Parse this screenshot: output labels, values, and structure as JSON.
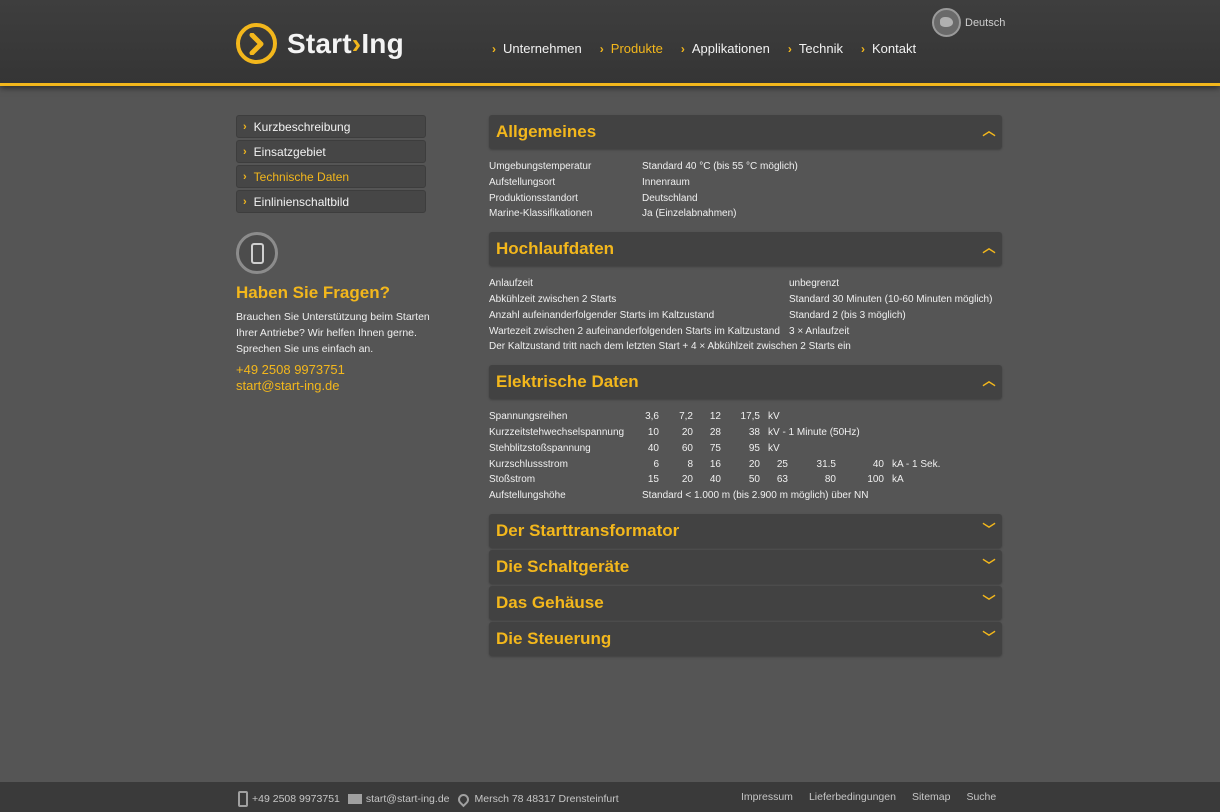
{
  "header": {
    "brand": {
      "part1": "Start",
      "sep": "›",
      "part2": "Ing"
    },
    "language": "Deutsch",
    "nav": [
      {
        "label": "Unternehmen",
        "active": false
      },
      {
        "label": "Produkte",
        "active": true
      },
      {
        "label": "Applikationen",
        "active": false
      },
      {
        "label": "Technik",
        "active": false
      },
      {
        "label": "Kontakt",
        "active": false
      }
    ]
  },
  "sidebar": {
    "items": [
      {
        "label": "Kurzbeschreibung",
        "active": false
      },
      {
        "label": "Einsatzgebiet",
        "active": false
      },
      {
        "label": "Technische Daten",
        "active": true
      },
      {
        "label": "Einlinienschaltbild",
        "active": false
      }
    ],
    "help": {
      "title": "Haben Sie Fragen?",
      "text": "Brauchen Sie Unterstützung beim Starten Ihrer Antriebe? Wir helfen Ihnen gerne. Sprechen Sie uns einfach an.",
      "phone": "+49 2508 9973751",
      "email": "start@start-ing.de"
    }
  },
  "sections": {
    "allgemeines": {
      "title": "Allgemeines",
      "rows": [
        {
          "k": "Umgebungstemperatur",
          "v": "Standard 40 °C (bis 55 °C möglich)"
        },
        {
          "k": "Aufstellungsort",
          "v": "Innenraum"
        },
        {
          "k": "Produktionsstandort",
          "v": "Deutschland"
        },
        {
          "k": "Marine-Klassifikationen",
          "v": "Ja (Einzelabnahmen)"
        }
      ]
    },
    "hochlauf": {
      "title": "Hochlaufdaten",
      "rows": [
        {
          "k": "Anlaufzeit",
          "v": "unbegrenzt"
        },
        {
          "k": "Abkühlzeit zwischen 2 Starts",
          "v": "Standard 30 Minuten (10-60 Minuten möglich)"
        },
        {
          "k": "Anzahl aufeinanderfolgender Starts im Kaltzustand",
          "v": "Standard 2 (bis 3 möglich)"
        },
        {
          "k": "Wartezeit zwischen 2 aufeinanderfolgenden Starts im Kaltzustand",
          "v": "3 × Anlaufzeit"
        }
      ],
      "note": "Der Kaltzustand tritt nach dem letzten Start + 4 × Abkühlzeit zwischen 2 Starts ein"
    },
    "elektrisch": {
      "title": "Elektrische Daten",
      "spannung": {
        "k": "Spannungsreihen",
        "vals": [
          "3,6",
          "7,2",
          "12",
          "17,5"
        ],
        "unit": "kV"
      },
      "kurzzeit": {
        "k": "Kurzzeitstehwechselspannung",
        "vals": [
          "10",
          "20",
          "28",
          "38"
        ],
        "unit": "kV - 1 Minute (50Hz)"
      },
      "blitz": {
        "k": "Stehblitzstoßspannung",
        "vals": [
          "40",
          "60",
          "75",
          "95"
        ],
        "unit": "kV"
      },
      "kurzschluss": {
        "k": "Kurzschlussstrom",
        "vals": [
          "6",
          "8",
          "16",
          "20",
          "25",
          "31.5",
          "40"
        ],
        "unit": "kA - 1 Sek."
      },
      "stoss": {
        "k": "Stoßstrom",
        "vals": [
          "15",
          "20",
          "40",
          "50",
          "63",
          "80",
          "100"
        ],
        "unit": "kA"
      },
      "hoehe": {
        "k": "Aufstellungshöhe",
        "v": "Standard < 1.000 m (bis 2.900 m möglich) über NN"
      }
    },
    "collapsed": [
      {
        "title": "Der Starttransformator"
      },
      {
        "title": "Die Schaltgeräte"
      },
      {
        "title": "Das Gehäuse"
      },
      {
        "title": "Die Steuerung"
      }
    ]
  },
  "footer": {
    "phone": "+49 2508 9973751",
    "email": "start@start-ing.de",
    "address": "Mersch 78 48317 Drensteinfurt",
    "links": [
      "Impressum",
      "Lieferbedingungen",
      "Sitemap",
      "Suche"
    ]
  },
  "icons": {
    "expanded": "chevron-up-icon",
    "collapsed": "chevron-down-icon"
  },
  "colors": {
    "accent": "#f3b71c",
    "background": "#555555",
    "header": "#3a3a3a"
  }
}
